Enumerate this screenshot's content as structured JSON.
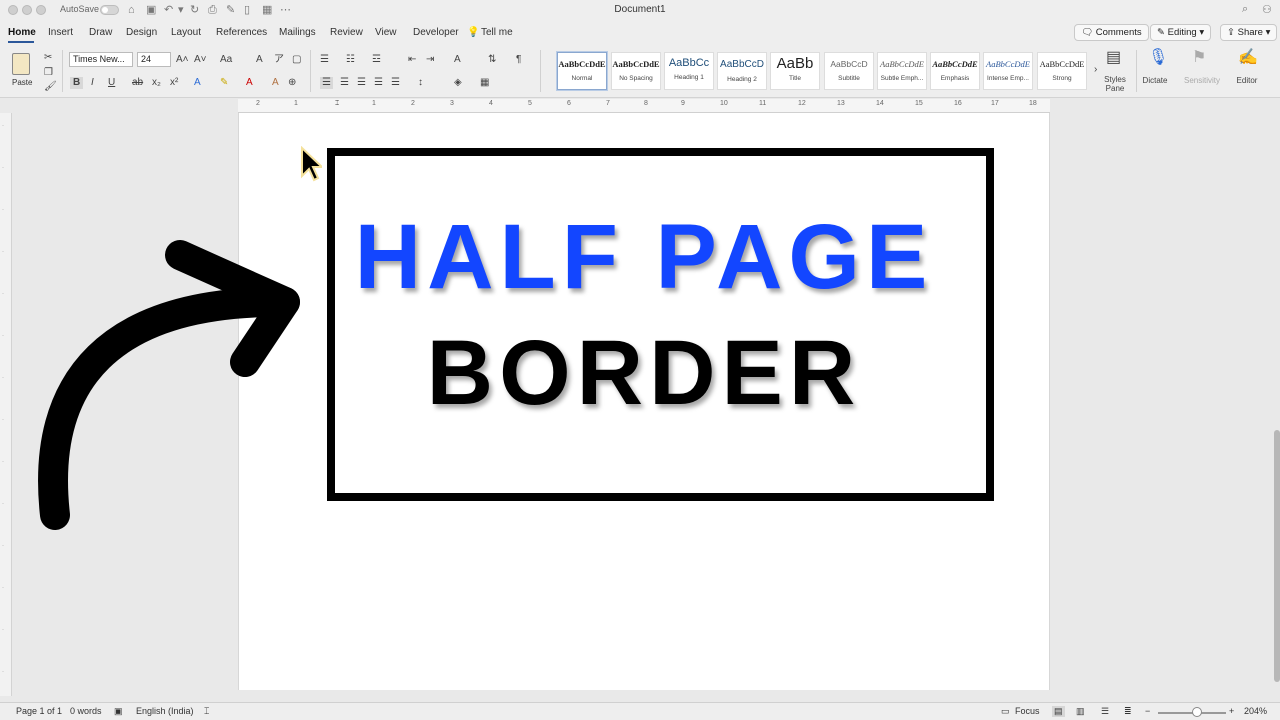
{
  "titlebar": {
    "autosave_label": "AutoSave",
    "document_title": "Document1"
  },
  "tabs": [
    "Home",
    "Insert",
    "Draw",
    "Design",
    "Layout",
    "References",
    "Mailings",
    "Review",
    "View",
    "Developer",
    "Tell me"
  ],
  "ribbon_right": {
    "comments_label": "Comments",
    "editing_label": "Editing",
    "share_label": "Share"
  },
  "ribbon": {
    "paste_label": "Paste",
    "font_name": "Times New...",
    "font_size": "24",
    "styles": [
      {
        "sample": "AaBbCcDdE",
        "name": "Normal"
      },
      {
        "sample": "AaBbCcDdE",
        "name": "No Spacing"
      },
      {
        "sample": "AaBbCc",
        "name": "Heading 1"
      },
      {
        "sample": "AaBbCcD",
        "name": "Heading 2"
      },
      {
        "sample": "AaBb",
        "name": "Title"
      },
      {
        "sample": "AaBbCcD",
        "name": "Subtitle"
      },
      {
        "sample": "AaBbCcDdE",
        "name": "Subtle Emph..."
      },
      {
        "sample": "AaBbCcDdE",
        "name": "Emphasis"
      },
      {
        "sample": "AaBbCcDdE",
        "name": "Intense Emp..."
      },
      {
        "sample": "AaBbCcDdE",
        "name": "Strong"
      }
    ],
    "styles_pane_label": "Styles Pane",
    "dictate_label": "Dictate",
    "sensitivity_label": "Sensitivity",
    "editor_label": "Editor"
  },
  "ruler_numbers": [
    "2",
    "1",
    "1",
    "2",
    "3",
    "4",
    "5",
    "6",
    "7",
    "8",
    "9",
    "10",
    "11",
    "12",
    "13",
    "14",
    "15",
    "16",
    "17",
    "18"
  ],
  "document": {
    "line1": "HALF PAGE",
    "line2": "BORDER",
    "line1_color": "#1346ff",
    "line2_color": "#000000"
  },
  "statusbar": {
    "page_info": "Page 1 of 1",
    "word_count": "0 words",
    "language": "English (India)",
    "focus_label": "Focus",
    "zoom_level": "204%"
  }
}
